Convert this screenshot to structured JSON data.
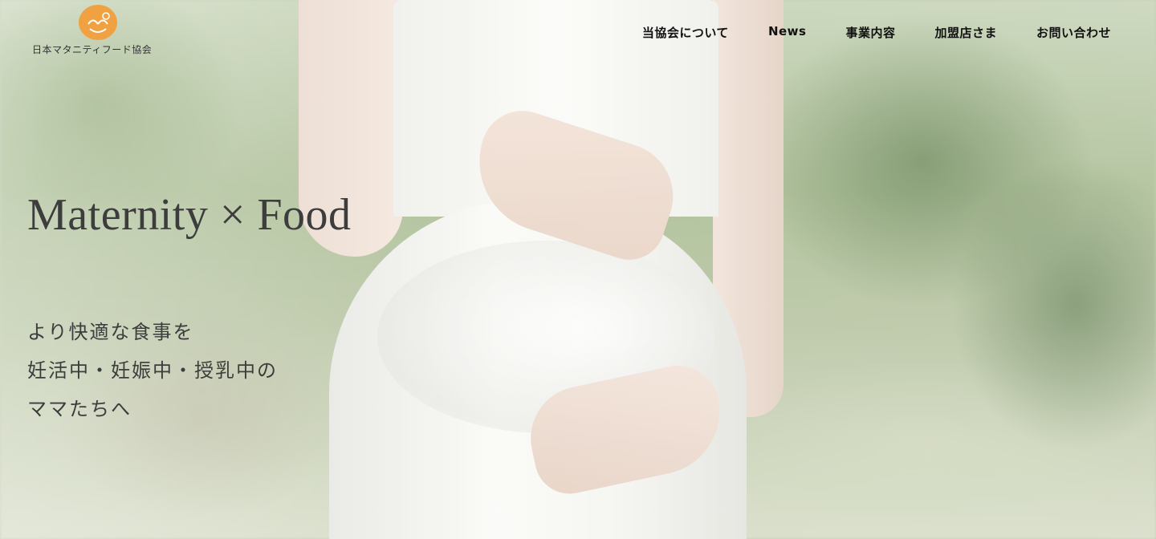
{
  "logo": {
    "text": "日本マタニティフード協会",
    "color": "#f0a242"
  },
  "nav": {
    "items": [
      {
        "label": "当協会について"
      },
      {
        "label": "News"
      },
      {
        "label": "事業内容"
      },
      {
        "label": "加盟店さま"
      },
      {
        "label": "お問い合わせ"
      }
    ]
  },
  "hero": {
    "headline": "Maternity × Food",
    "lines": [
      "より快適な食事を",
      "妊活中・妊娠中・授乳中の",
      "ママたちへ"
    ]
  }
}
